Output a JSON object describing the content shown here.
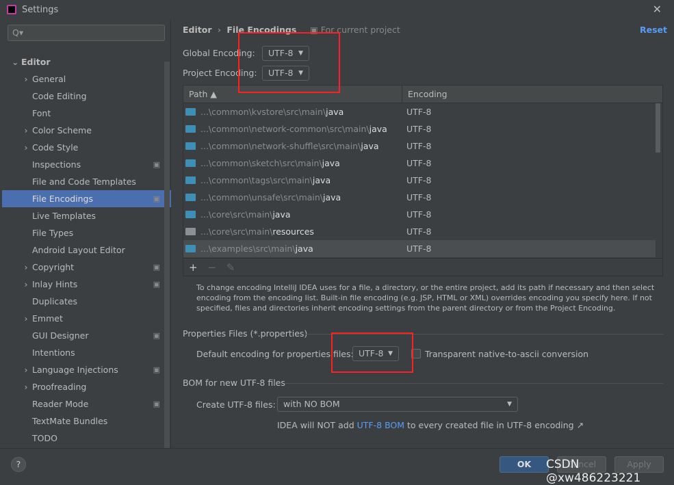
{
  "window": {
    "title": "Settings",
    "close": "✕"
  },
  "sidebar": {
    "search_placeholder": "Q▾",
    "items": [
      {
        "label": "Editor",
        "expand": "⌄",
        "level": 0
      },
      {
        "label": "General",
        "expand": "›",
        "level": 1
      },
      {
        "label": "Code Editing",
        "level": 1
      },
      {
        "label": "Font",
        "level": 1
      },
      {
        "label": "Color Scheme",
        "expand": "›",
        "level": 1
      },
      {
        "label": "Code Style",
        "expand": "›",
        "level": 1
      },
      {
        "label": "Inspections",
        "level": 1,
        "copy": true
      },
      {
        "label": "File and Code Templates",
        "level": 1
      },
      {
        "label": "File Encodings",
        "level": 1,
        "copy": true,
        "selected": true
      },
      {
        "label": "Live Templates",
        "level": 1
      },
      {
        "label": "File Types",
        "level": 1
      },
      {
        "label": "Android Layout Editor",
        "level": 1
      },
      {
        "label": "Copyright",
        "expand": "›",
        "level": 1,
        "copy": true
      },
      {
        "label": "Inlay Hints",
        "expand": "›",
        "level": 1,
        "copy": true
      },
      {
        "label": "Duplicates",
        "level": 1
      },
      {
        "label": "Emmet",
        "expand": "›",
        "level": 1
      },
      {
        "label": "GUI Designer",
        "level": 1,
        "copy": true
      },
      {
        "label": "Intentions",
        "level": 1
      },
      {
        "label": "Language Injections",
        "expand": "›",
        "level": 1,
        "copy": true
      },
      {
        "label": "Proofreading",
        "expand": "›",
        "level": 1
      },
      {
        "label": "Reader Mode",
        "level": 1,
        "copy": true
      },
      {
        "label": "TextMate Bundles",
        "level": 1
      },
      {
        "label": "TODO",
        "level": 1
      }
    ]
  },
  "header": {
    "breadcrumb_parent": "Editor",
    "breadcrumb_sep": "›",
    "breadcrumb_current": "File Encodings",
    "scope": "For current project",
    "reset": "Reset"
  },
  "encoding": {
    "global_label": "Global Encoding:",
    "global_value": "UTF-8",
    "project_label": "Project Encoding:",
    "project_value": "UTF-8"
  },
  "table": {
    "col_path": "Path ▲",
    "col_encoding": "Encoding",
    "rows": [
      {
        "prefix": "...\\common\\kvstore\\src\\main\\",
        "suffix": "java",
        "enc": "UTF-8"
      },
      {
        "prefix": "...\\common\\network-common\\src\\main\\",
        "suffix": "java",
        "enc": "UTF-8"
      },
      {
        "prefix": "...\\common\\network-shuffle\\src\\main\\",
        "suffix": "java",
        "enc": "UTF-8"
      },
      {
        "prefix": "...\\common\\sketch\\src\\main\\",
        "suffix": "java",
        "enc": "UTF-8"
      },
      {
        "prefix": "...\\common\\tags\\src\\main\\",
        "suffix": "java",
        "enc": "UTF-8"
      },
      {
        "prefix": "...\\common\\unsafe\\src\\main\\",
        "suffix": "java",
        "enc": "UTF-8"
      },
      {
        "prefix": "...\\core\\src\\main\\",
        "suffix": "java",
        "enc": "UTF-8"
      },
      {
        "prefix": "...\\core\\src\\main\\",
        "suffix": "resources",
        "enc": "UTF-8",
        "res": true
      },
      {
        "prefix": "...\\examples\\src\\main\\",
        "suffix": "java",
        "enc": "UTF-8",
        "hl": true
      }
    ],
    "add": "+",
    "remove": "−",
    "edit": "✎"
  },
  "help_text": "To change encoding IntelliJ IDEA uses for a file, a directory, or the entire project, add its path if necessary and then select encoding from the encoding list. Built-in file encoding (e.g. JSP, HTML or XML) overrides encoding you specify here. If not specified, files and directories inherit encoding settings from the parent directory or from the Project Encoding.",
  "properties": {
    "section": "Properties Files (*.properties)",
    "default_label": "Default encoding for properties files:",
    "default_value": "UTF-8",
    "native_label": "Transparent native-to-ascii conversion"
  },
  "bom": {
    "section": "BOM for new UTF-8 files",
    "create_label": "Create UTF-8 files:",
    "create_value": "with NO BOM",
    "note_pre": "IDEA will NOT add ",
    "note_link": "UTF-8 BOM",
    "note_post": " to every created file in UTF-8 encoding ↗"
  },
  "footer": {
    "help": "?",
    "ok": "OK",
    "cancel": "Cancel",
    "apply": "Apply",
    "watermark": "CSDN @xw486223221"
  }
}
